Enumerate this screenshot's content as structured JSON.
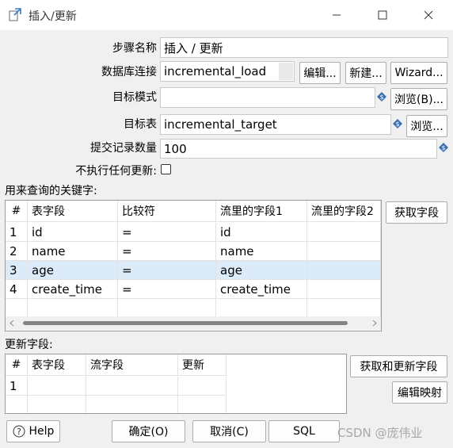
{
  "window": {
    "title": "插入/更新"
  },
  "form": {
    "step_name_label": "步骤名称",
    "step_name_value": "插入 / 更新",
    "db_conn_label": "数据库连接",
    "db_conn_value": "incremental_load",
    "edit_btn": "编辑...",
    "new_btn": "新建...",
    "wizard_btn": "Wizard...",
    "target_schema_label": "目标模式",
    "target_schema_value": "",
    "browse_b_btn": "浏览(B)...",
    "target_table_label": "目标表",
    "target_table_value": "incremental_target",
    "browse_btn": "浏览...",
    "commit_size_label": "提交记录数量",
    "commit_size_value": "100",
    "no_update_label": "不执行任何更新:"
  },
  "keys": {
    "section_label": "用来查询的关键字:",
    "get_fields_btn": "获取字段",
    "headers": [
      "#",
      "表字段",
      "比较符",
      "流里的字段1",
      "流里的字段2"
    ],
    "rows": [
      [
        "1",
        "id",
        "=",
        "id",
        ""
      ],
      [
        "2",
        "name",
        "=",
        "name",
        ""
      ],
      [
        "3",
        "age",
        "=",
        "age",
        ""
      ],
      [
        "4",
        "create_time",
        "=",
        "create_time",
        ""
      ]
    ]
  },
  "update": {
    "section_label": "更新字段:",
    "get_update_btn": "获取和更新字段",
    "edit_mapping_btn": "编辑映射",
    "headers": [
      "#",
      "表字段",
      "流字段",
      "更新"
    ],
    "rows": [
      [
        "1",
        "",
        "",
        ""
      ]
    ]
  },
  "bottom": {
    "help_btn": "Help",
    "ok_btn": "确定(O)",
    "cancel_btn": "取消(C)",
    "sql_btn": "SQL",
    "watermark": "CSDN @庞伟业"
  }
}
